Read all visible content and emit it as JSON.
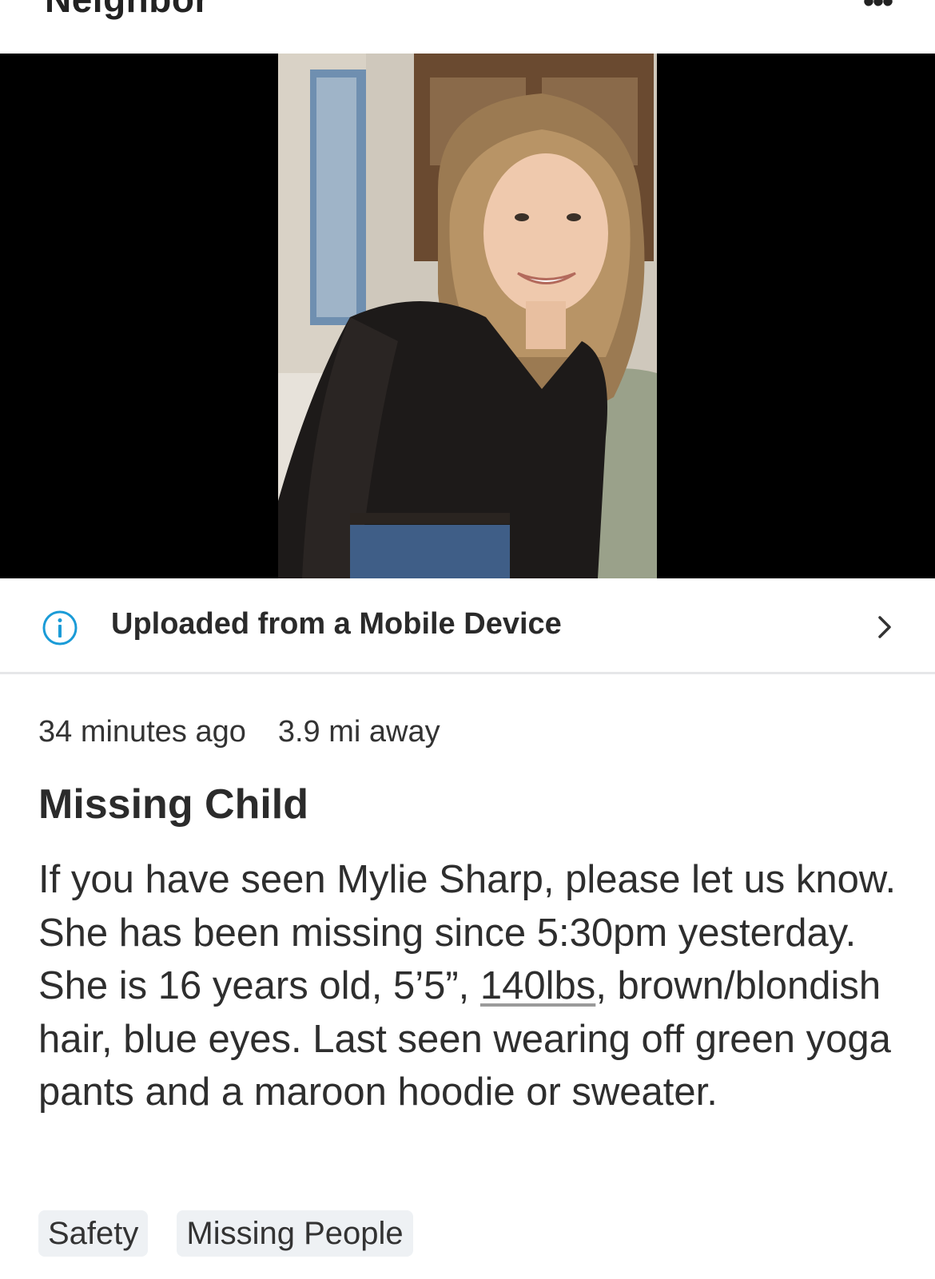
{
  "header": {
    "title": "Neighbor",
    "more_icon": "more-dots-icon"
  },
  "media": {
    "image_alt": "Photo of a smiling girl with long brown/blonde hair wearing a black sweater"
  },
  "upload_info": {
    "label": "Uploaded from a Mobile Device",
    "icon": "info-icon",
    "accent_color": "#1a9bd7"
  },
  "post": {
    "time_ago": "34 minutes ago",
    "distance": "3.9 mi away",
    "title": "Missing Child",
    "body_part1": "If you have seen Mylie Sharp, please let us know.  She has been missing since 5:30pm yesterday.  She is 16 years old, 5’5”, ",
    "body_link": "140lbs",
    "body_part2": ", brown/blondish hair, blue eyes.  Last seen wearing off green yoga pants and a maroon hoodie or sweater.",
    "tags": [
      "Safety",
      "Missing People"
    ]
  }
}
